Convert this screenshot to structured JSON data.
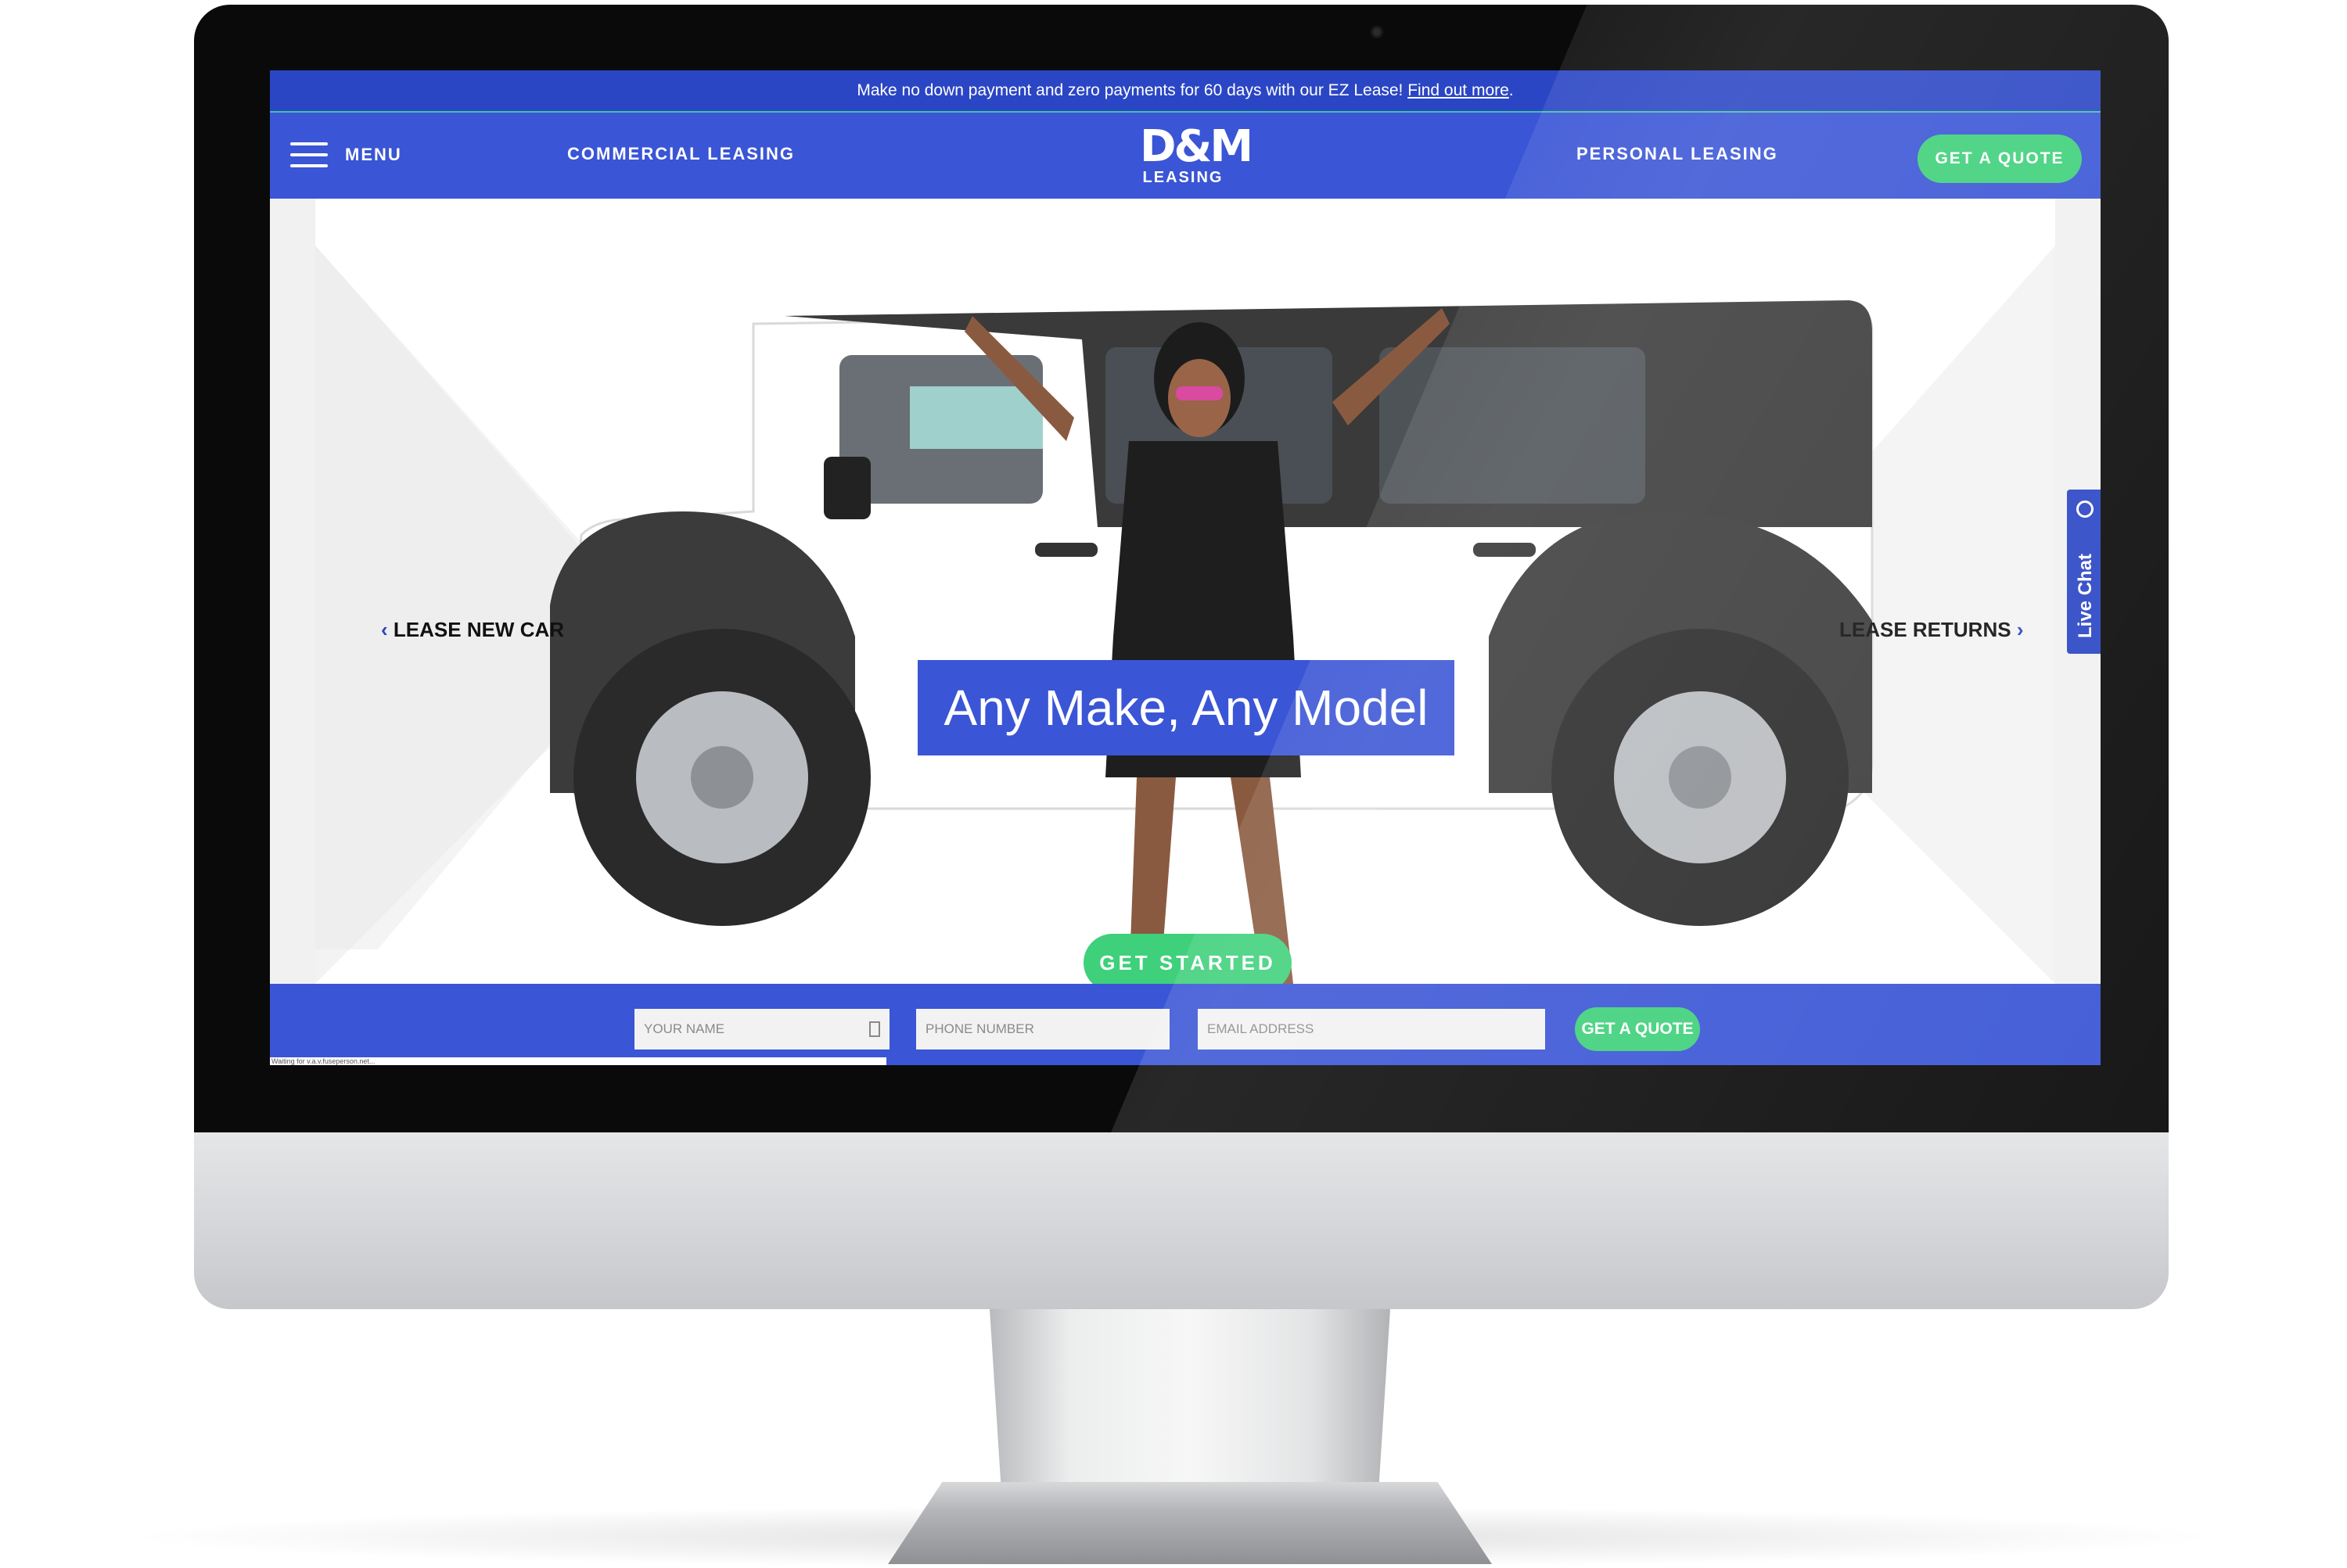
{
  "promo": {
    "text": "Make no down payment and zero payments for 60 days with our EZ Lease! ",
    "link": "Find out more",
    "tail": "."
  },
  "nav": {
    "menu_label": "MENU",
    "commercial": "COMMERCIAL LEASING",
    "personal": "PERSONAL LEASING",
    "quote_button": "GET A QUOTE",
    "logo_mark": "D&M",
    "logo_sub": "LEASING"
  },
  "hero": {
    "left_link": "LEASE NEW CAR",
    "right_link": "LEASE RETURNS",
    "headline": "Any Make, Any Model",
    "cta": "GET STARTED",
    "chevron_left": "‹",
    "chevron_right": "›"
  },
  "live_chat": {
    "label": "Live Chat"
  },
  "form": {
    "name_placeholder": "YOUR NAME",
    "phone_placeholder": "PHONE NUMBER",
    "email_placeholder": "EMAIL ADDRESS",
    "submit": "GET A QUOTE",
    "status": "Waiting for v.a.v.fuseperson.net..."
  },
  "colors": {
    "brand_blue": "#3a55d5",
    "promo_blue": "#2b46c4",
    "accent_green": "#3ed07a"
  }
}
